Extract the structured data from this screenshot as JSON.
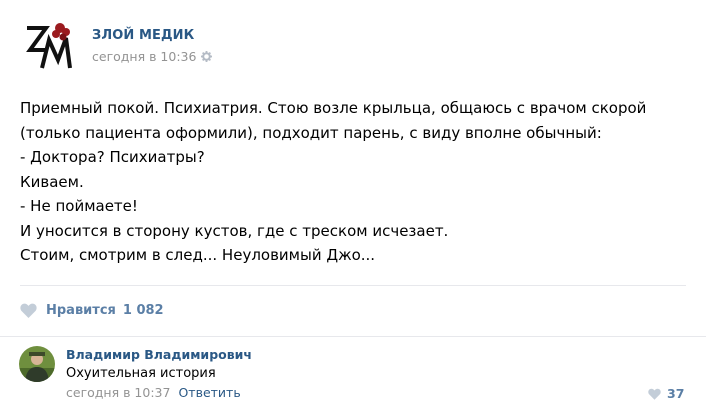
{
  "post": {
    "author": "ЗЛОЙ МЕДИК",
    "time": "сегодня в 10:36",
    "logo_letters": "ЗМ",
    "lines": [
      "Приемный покой. Психиатрия. Стою возле крыльца, общаюсь с врачом скорой",
      "(только пациента оформили), подходит парень, с виду вполне обычный:",
      "- Доктора? Психиатры?",
      "Киваем.",
      "- Не поймаете!",
      "И уносится в сторону кустов, где с треском исчезает.",
      "Стоим, смотрим в след... Неуловимый Джо..."
    ],
    "like_label": "Нравится",
    "like_count": "1 082"
  },
  "comment": {
    "author": "Владимир Владимирович",
    "text": "Охуительная история",
    "time": "сегодня в 10:37",
    "reply_label": "Ответить",
    "like_count": "37"
  },
  "icons": {
    "gear": "gear-icon",
    "heart": "heart-icon"
  },
  "colors": {
    "link": "#2a5885",
    "muted": "#939393",
    "like": "#5b7fa6",
    "logo_red": "#9b1b1f"
  }
}
